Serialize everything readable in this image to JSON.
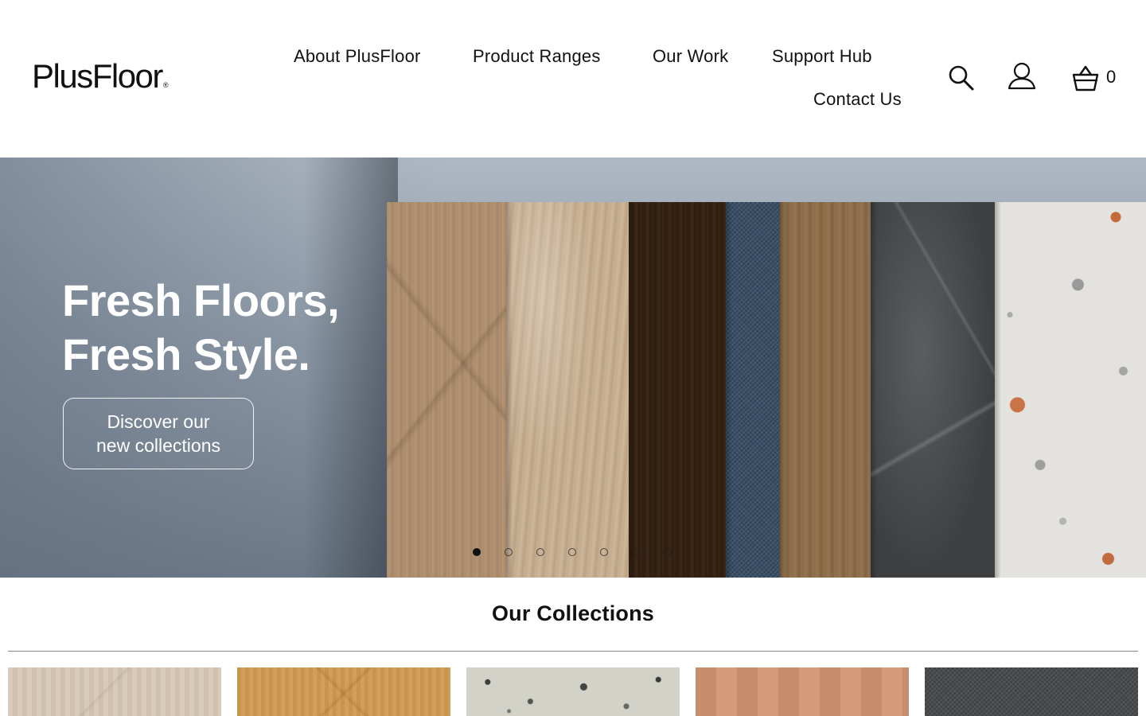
{
  "brand": {
    "logo_text": "PlusFloor",
    "registered_mark": "®"
  },
  "nav": {
    "items": [
      {
        "label": "About PlusFloor"
      },
      {
        "label": "Product Ranges"
      },
      {
        "label": "Our Work"
      },
      {
        "label": "Support Hub"
      },
      {
        "label": "Contact Us"
      }
    ]
  },
  "header_icons": {
    "search": "search-icon",
    "account": "user-icon",
    "cart": "basket-icon",
    "cart_count": "0"
  },
  "hero": {
    "title_line1": "Fresh Floors,",
    "title_line2": "Fresh Style.",
    "cta_line1": "Discover our",
    "cta_line2": "new collections",
    "slide_count": 7,
    "active_slide": 1
  },
  "collections": {
    "title": "Our Collections",
    "card_count": 5
  },
  "colors": {
    "text": "#111111",
    "background": "#ffffff",
    "divider": "#8a8a8a"
  }
}
